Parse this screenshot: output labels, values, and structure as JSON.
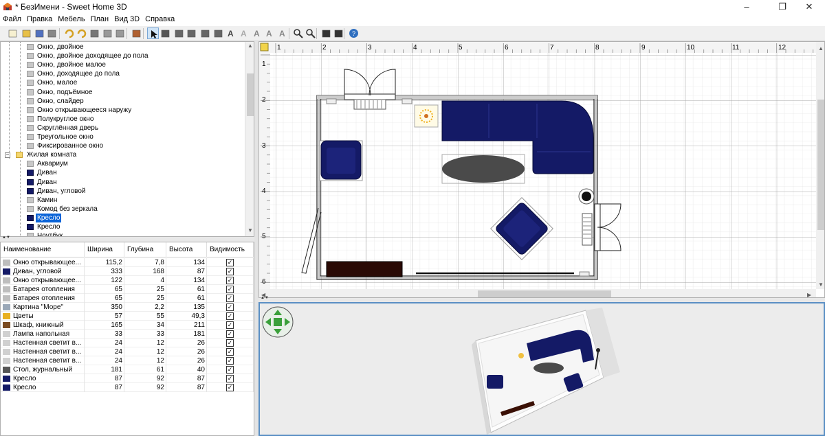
{
  "window": {
    "title": "* БезИмени - Sweet Home 3D",
    "minimize": "–",
    "maximize": "❐",
    "close": "✕"
  },
  "menu": [
    "Файл",
    "Правка",
    "Мебель",
    "План",
    "Вид 3D",
    "Справка"
  ],
  "toolbar_icons": [
    "new-file-icon",
    "open-icon",
    "save-icon",
    "cut-tool-icon",
    "undo-icon",
    "redo-icon",
    "cut-icon",
    "copy-icon",
    "paste-icon",
    "add-furniture-icon",
    "select-arrow-icon",
    "pan-hand-icon",
    "create-walls-icon",
    "create-rooms-icon",
    "create-polylines-icon",
    "create-dimensions-icon",
    "add-text-icon",
    "text-style-icon",
    "text-bold-icon",
    "text-italic-icon",
    "text-size-icon",
    "zoom-in-icon",
    "zoom-out-icon",
    "photo-icon",
    "video-icon",
    "help-icon"
  ],
  "catalog": {
    "items": [
      {
        "label": "Окно, двойное",
        "level": 2
      },
      {
        "label": "Окно, двойное доходящее до пола",
        "level": 2
      },
      {
        "label": "Окно, двойное малое",
        "level": 2
      },
      {
        "label": "Окно, доходящее до пола",
        "level": 2
      },
      {
        "label": "Окно, малое",
        "level": 2
      },
      {
        "label": "Окно, подъёмное",
        "level": 2
      },
      {
        "label": "Окно, слайдер",
        "level": 2
      },
      {
        "label": "Окно открывающееся наружу",
        "level": 2
      },
      {
        "label": "Полукруглое окно",
        "level": 2
      },
      {
        "label": "Скруглённая дверь",
        "level": 2
      },
      {
        "label": "Треугольное окно",
        "level": 2
      },
      {
        "label": "Фиксированное окно",
        "level": 2
      },
      {
        "label": "Жилая комната",
        "level": 1
      },
      {
        "label": "Аквариум",
        "level": 2
      },
      {
        "label": "Диван",
        "level": 2
      },
      {
        "label": "Диван",
        "level": 2
      },
      {
        "label": "Диван, угловой",
        "level": 2
      },
      {
        "label": "Камин",
        "level": 2
      },
      {
        "label": "Комод без зеркала",
        "level": 2
      },
      {
        "label": "Кресло",
        "level": 2,
        "selected": true
      },
      {
        "label": "Кресло",
        "level": 2
      },
      {
        "label": "Ноутбук",
        "level": 2
      }
    ]
  },
  "furniture_table": {
    "columns": [
      "Наименование",
      "Ширина",
      "Глубина",
      "Высота",
      "Видимость"
    ],
    "rows": [
      {
        "name": "Окно открывающее...",
        "w": "115,2",
        "d": "7,8",
        "h": "134",
        "visible": true
      },
      {
        "name": "Диван, угловой",
        "w": "333",
        "d": "168",
        "h": "87",
        "visible": true
      },
      {
        "name": "Окно открывающее...",
        "w": "122",
        "d": "4",
        "h": "134",
        "visible": true
      },
      {
        "name": "Батарея отопления",
        "w": "65",
        "d": "25",
        "h": "61",
        "visible": true
      },
      {
        "name": "Батарея отопления",
        "w": "65",
        "d": "25",
        "h": "61",
        "visible": true
      },
      {
        "name": "Картина \"Море\"",
        "w": "350",
        "d": "2,2",
        "h": "135",
        "visible": true
      },
      {
        "name": "Цветы",
        "w": "57",
        "d": "55",
        "h": "49,3",
        "visible": true
      },
      {
        "name": "Шкаф, книжный",
        "w": "165",
        "d": "34",
        "h": "211",
        "visible": true
      },
      {
        "name": "Лампа напольная",
        "w": "33",
        "d": "33",
        "h": "181",
        "visible": true
      },
      {
        "name": "Настенная светит в...",
        "w": "24",
        "d": "12",
        "h": "26",
        "visible": true
      },
      {
        "name": "Настенная светит в...",
        "w": "24",
        "d": "12",
        "h": "26",
        "visible": true
      },
      {
        "name": "Настенная светит в...",
        "w": "24",
        "d": "12",
        "h": "26",
        "visible": true
      },
      {
        "name": "Стол, журнальный",
        "w": "181",
        "d": "61",
        "h": "40",
        "visible": true
      },
      {
        "name": "Кресло",
        "w": "87",
        "d": "92",
        "h": "87",
        "visible": true
      },
      {
        "name": "Кресло",
        "w": "87",
        "d": "92",
        "h": "87",
        "visible": true
      }
    ]
  },
  "plan": {
    "ruler_top": [
      "1",
      "2",
      "3",
      "4",
      "5",
      "6",
      "7",
      "8",
      "9",
      "10",
      "11",
      "12"
    ],
    "ruler_left": [
      "1",
      "2",
      "3",
      "4",
      "5",
      "6"
    ]
  },
  "colors": {
    "sofa": "#141a66",
    "selection": "#0a64d8",
    "wall": "#222222",
    "view3d_border": "#5a8fc4"
  }
}
